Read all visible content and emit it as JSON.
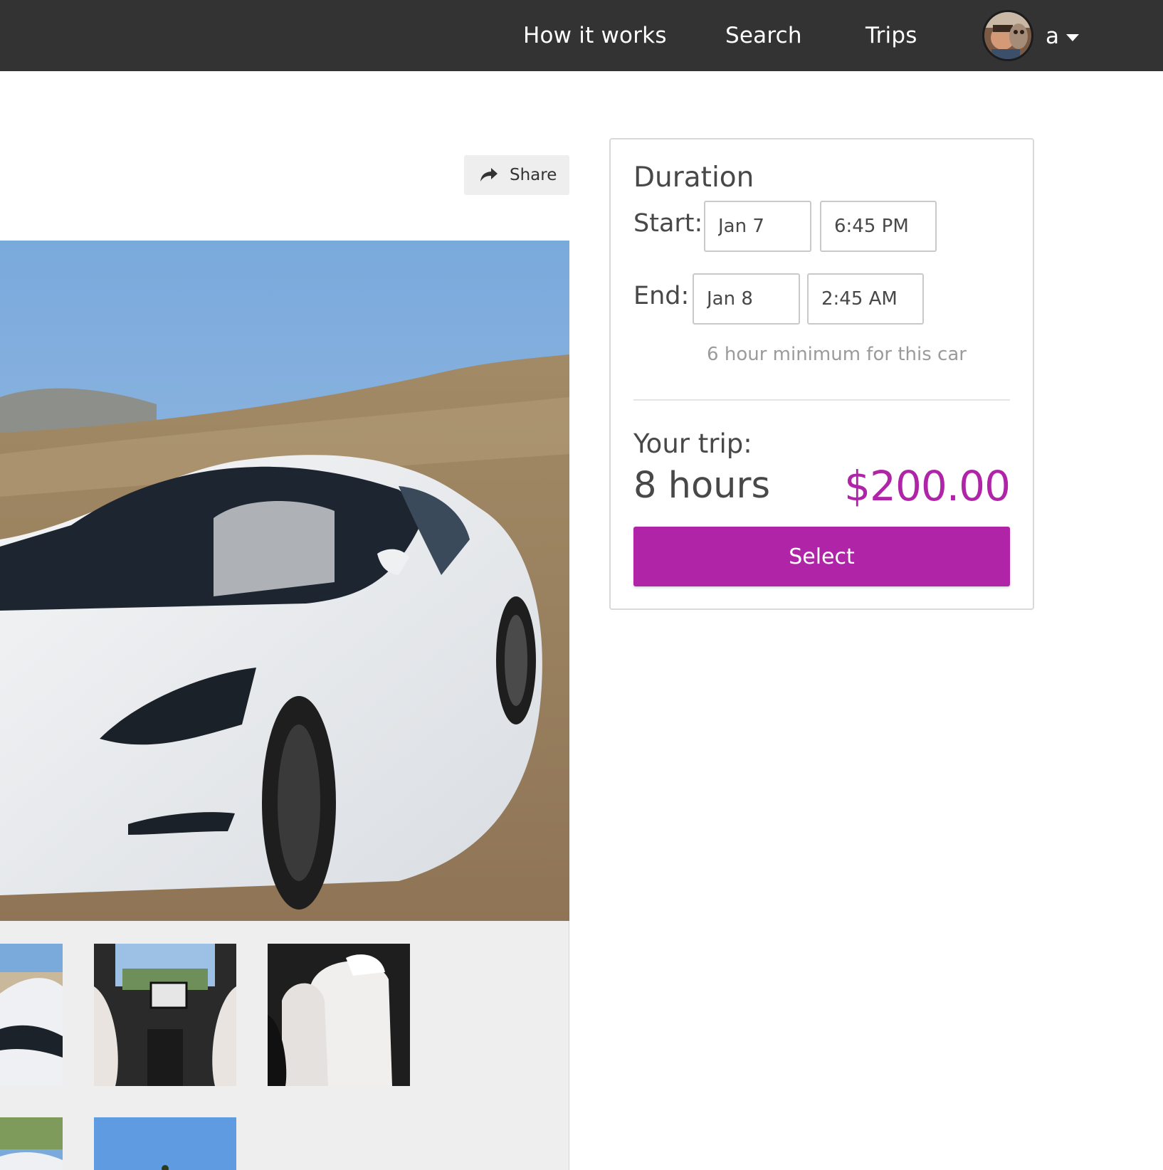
{
  "nav": {
    "links": [
      {
        "label": "How it works"
      },
      {
        "label": "Search"
      },
      {
        "label": "Trips"
      }
    ],
    "user_name": "a"
  },
  "share": {
    "label": "Share"
  },
  "booking": {
    "duration_title": "Duration",
    "start": {
      "label": "Start:",
      "date": "Jan 7",
      "time": "6:45 PM"
    },
    "end": {
      "label": "End:",
      "date": "Jan 8",
      "time": "2:45 AM"
    },
    "minimum_note": "6 hour minimum for this car",
    "trip_label": "Your trip:",
    "trip_hours": "8 hours",
    "trip_price": "$200.00",
    "select_label": "Select"
  },
  "colors": {
    "nav_bg": "#333333",
    "accent": "#b025a8",
    "thumb_bg": "#eeeeee"
  },
  "icons": [
    "share-arrow-icon",
    "caret-down-icon",
    "avatar-photo"
  ]
}
